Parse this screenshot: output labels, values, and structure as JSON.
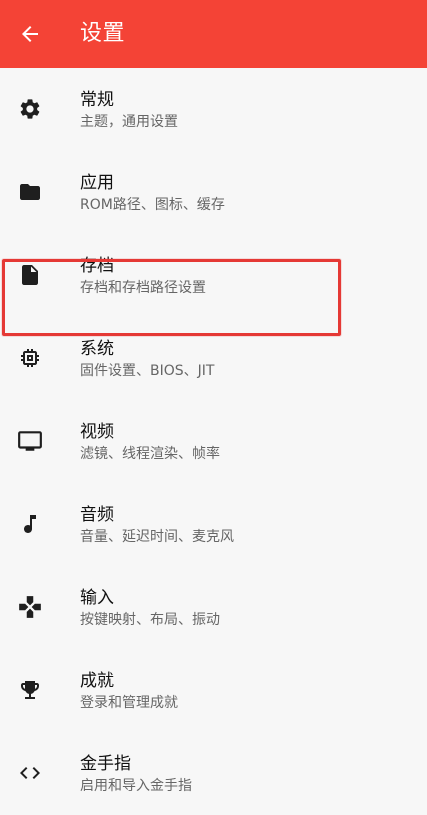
{
  "app_bar": {
    "title": "设置",
    "color": "#f44336"
  },
  "items": [
    {
      "icon": "gear-icon",
      "title": "常规",
      "subtitle": "主题，通用设置"
    },
    {
      "icon": "folder-icon",
      "title": "应用",
      "subtitle": "ROM路径、图标、缓存"
    },
    {
      "icon": "file-icon",
      "title": "存档",
      "subtitle": "存档和存档路径设置"
    },
    {
      "icon": "chip-icon",
      "title": "系统",
      "subtitle": "固件设置、BIOS、JIT"
    },
    {
      "icon": "monitor-icon",
      "title": "视频",
      "subtitle": "滤镜、线程渲染、帧率"
    },
    {
      "icon": "music-note-icon",
      "title": "音频",
      "subtitle": "音量、延迟时间、麦克风"
    },
    {
      "icon": "dpad-icon",
      "title": "输入",
      "subtitle": "按键映射、布局、振动"
    },
    {
      "icon": "trophy-icon",
      "title": "成就",
      "subtitle": "登录和管理成就"
    },
    {
      "icon": "code-icon",
      "title": "金手指",
      "subtitle": "启用和导入金手指"
    }
  ],
  "highlight_color": "#e53935"
}
